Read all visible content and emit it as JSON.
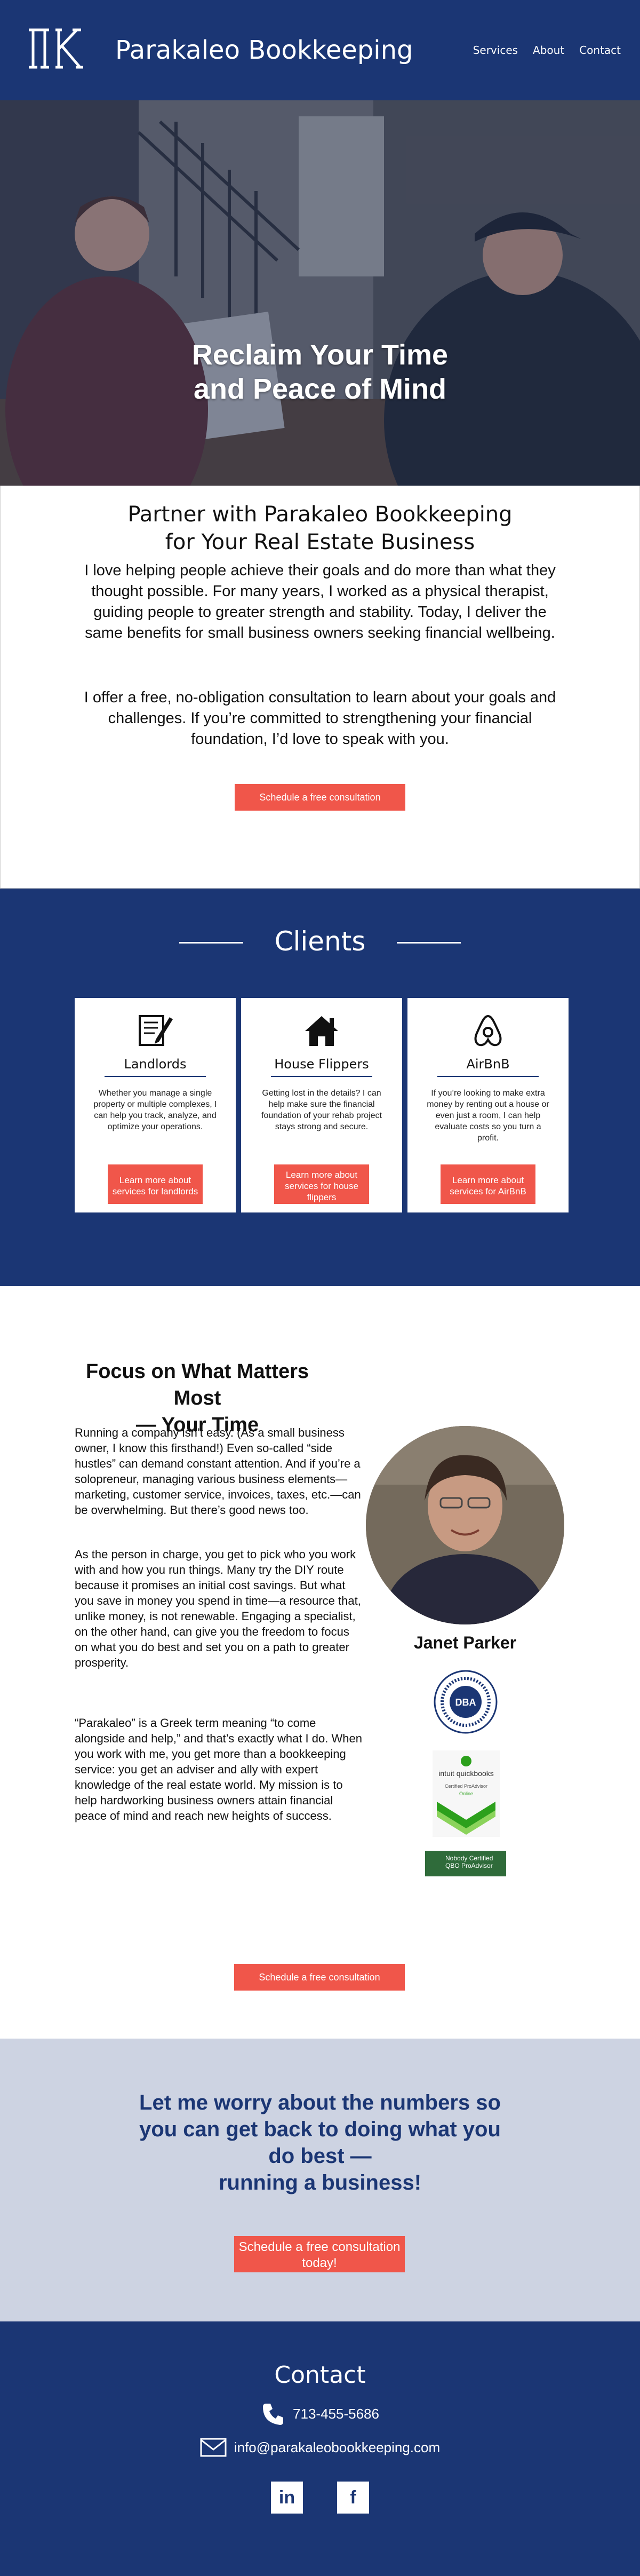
{
  "header": {
    "logo_mark": "ΠK",
    "brand": "Parakaleo Bookkeeping",
    "nav": [
      "Services",
      "About",
      "Contact"
    ]
  },
  "hero": {
    "title_line1": "Reclaim Your Time",
    "title_line2": "and Peace of Mind"
  },
  "intro": {
    "heading_line1": "Partner with Parakaleo Bookkeeping",
    "heading_line2": "for Your Real Estate Business",
    "p1": "I love helping people achieve their goals and do more than what they thought possible. For many years, I worked as a physical therapist, guiding people to greater strength and stability. Today, I deliver the same benefits for small business owners seeking financial wellbeing.",
    "p2": "I offer a free, no-obligation consultation to learn about your goals and challenges. If you’re committed to strengthening your financial foundation, I’d love to speak with you.",
    "cta": "Schedule a free consultation"
  },
  "clients": {
    "title": "Clients",
    "cards": [
      {
        "icon": "document-pen-icon",
        "title": "Landlords",
        "text": "Whether you manage a single property or multiple complexes, I can help you track, analyze, and optimize your operations.",
        "button": "Learn more about services for landlords"
      },
      {
        "icon": "house-icon",
        "title": "House Flippers",
        "text": "Getting lost in the details? I can help make sure the financial foundation of your rehab project stays strong and secure.",
        "button": "Learn more about services for house flippers"
      },
      {
        "icon": "airbnb-icon",
        "title": "AirBnB",
        "text": "If you’re looking to make extra money by renting out a house or even just a room, I can help evaluate costs so you turn a profit.",
        "button": "Learn more about services for AirBnB"
      }
    ]
  },
  "focus": {
    "heading_line1": "Focus on What Matters Most",
    "heading_line2": "— Your Time",
    "p1": "Running a company isn’t easy. (As a small business owner, I know this firsthand!) Even so-called “side hustles” can demand constant attention. And if you’re a solopreneur, managing various business elements—marketing, customer service, invoices, taxes, etc.—can be overwhelming. But there’s good news too.",
    "p2": "As the person in charge, you get to pick who you work with and how you run things. Many try the DIY route because it promises an initial cost savings. But what you save in money you spend in time—a resource that, unlike money, is not renewable. Engaging a specialist, on the other hand, can give you the freedom to focus on what you do best and set you on a path to greater prosperity.",
    "p3": "“Parakaleo” is a Greek term meaning “to come alongside and help,” and that’s exactly what I do. When you work with me, you get more than a bookkeeping service: you get an adviser and ally with expert knowledge of the real estate world. My mission is to help hardworking business owners attain financial peace of mind and reach new heights of success.",
    "name": "Janet Parker",
    "badge_dba": "DBA",
    "badge_qb_brand": "intuit quickbooks",
    "badge_qb_line1": "Certified ProAdvisor",
    "badge_qb_line2": "Online",
    "badge_green_line1": "Nobody Certified",
    "badge_green_line2": "QBO ProAdvisor",
    "cta": "Schedule a free consultation"
  },
  "worry": {
    "line1": "Let me worry about the numbers so",
    "line2": "you can get back to doing what you",
    "line3": "do best —",
    "line4": "running a business!",
    "cta_line1": "Schedule a free consultation",
    "cta_line2": "today!"
  },
  "contact": {
    "title": "Contact",
    "phone": "713-455-5686",
    "email": "info@parakaleobookkeeping.com",
    "social_linkedin": "in",
    "social_facebook": "f"
  },
  "colors": {
    "navy": "#1b3674",
    "coral": "#f0564a",
    "light_blue_gray": "#cdd3e2"
  }
}
